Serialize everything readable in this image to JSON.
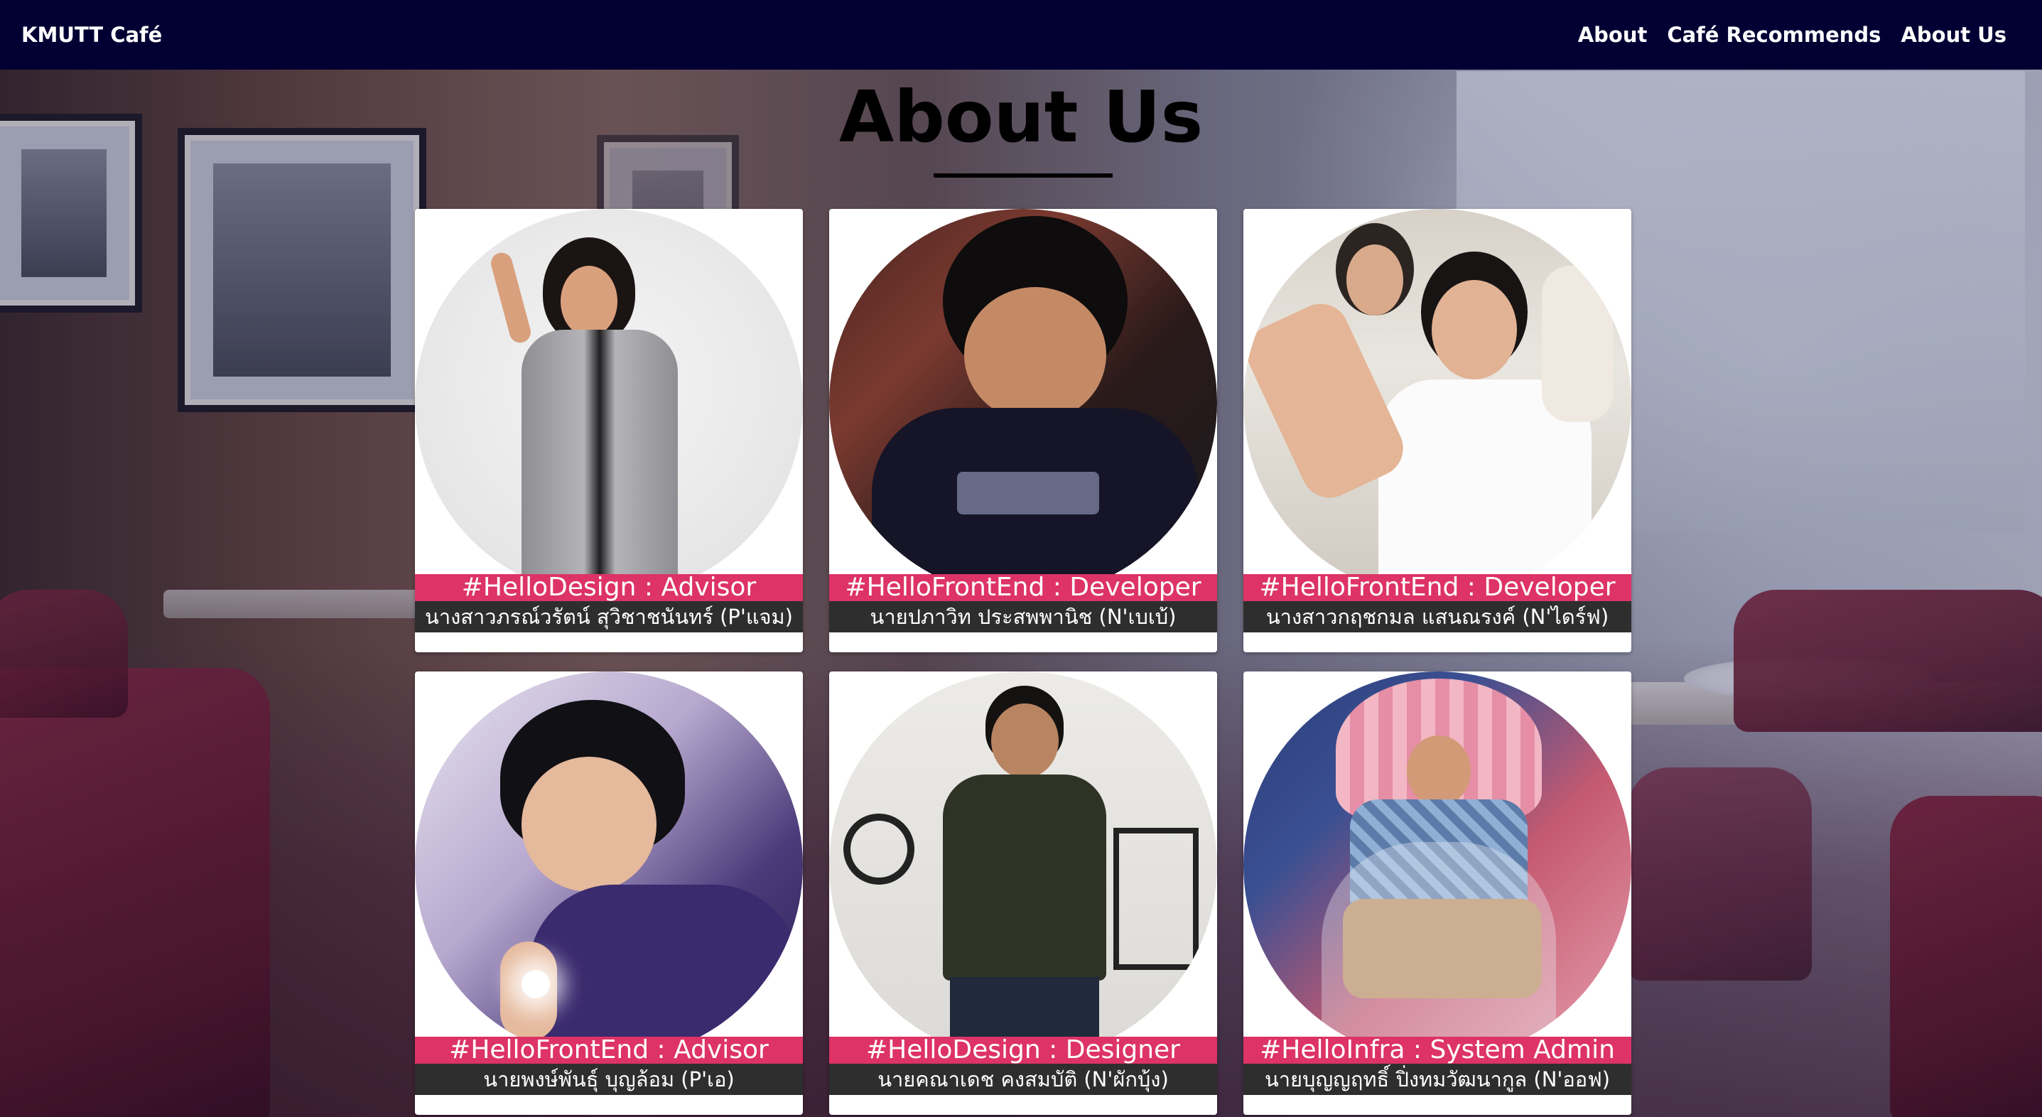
{
  "navbar": {
    "brand": "KMUTT Café",
    "links": [
      "About",
      "Café Recommends",
      "About Us"
    ]
  },
  "page": {
    "title": "About Us"
  },
  "members": [
    {
      "role": "#HelloDesign : Advisor",
      "name": "นางสาวภรณ์วรัตน์ สุวิชาชนันทร์ (P'แจม)"
    },
    {
      "role": "#HelloFrontEnd : Developer",
      "name": "นายปภาวิท ประสพพานิช (N'เบเบ้)"
    },
    {
      "role": "#HelloFrontEnd : Developer",
      "name": "นางสาวกฤชกมล แสนณรงค์ (N'ไดร์ฟ)"
    },
    {
      "role": "#HelloFrontEnd : Advisor",
      "name": "นายพงษ์พันธุ์ บุญล้อม (P'เอ)"
    },
    {
      "role": "#HelloDesign : Designer",
      "name": "นายคณาเดช คงสมบัติ (N'ผักบุ้ง)"
    },
    {
      "role": "#HelloInfra : System Admin",
      "name": "นายบุญญฤทธิ์ ปิ่งทมวัฒนากูล (N'ออฟ)"
    }
  ],
  "colors": {
    "navbar": "#020033",
    "role_banner": "#dd3366",
    "name_banner": "#2f2e2e"
  }
}
